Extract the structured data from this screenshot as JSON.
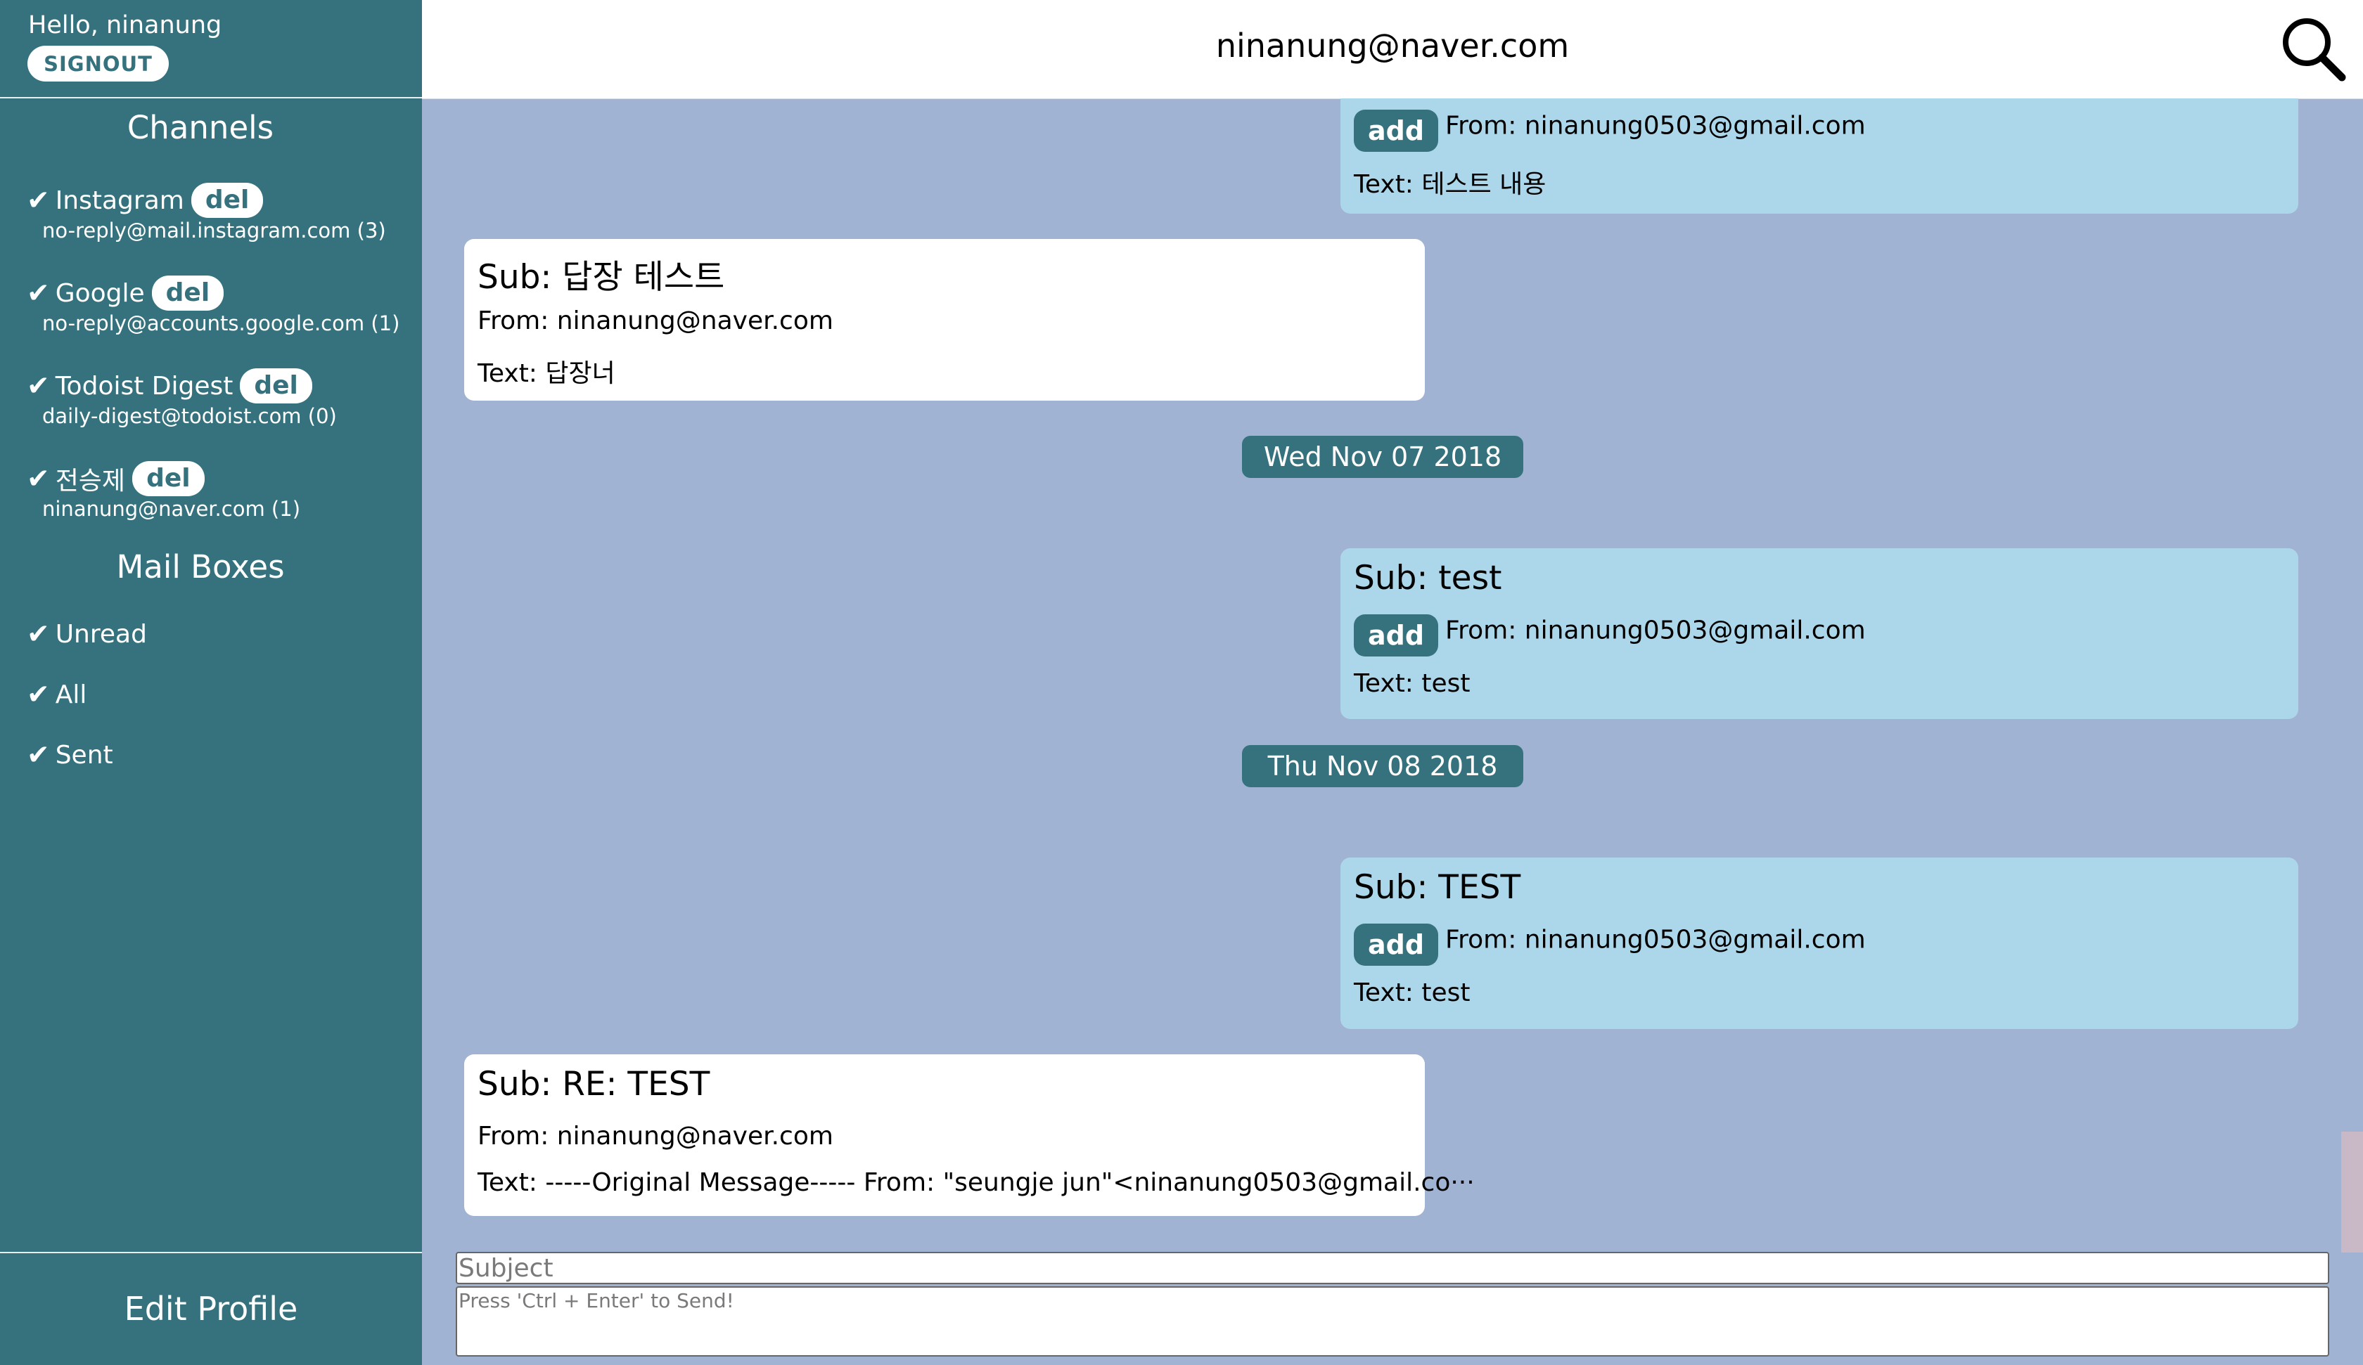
{
  "sidebar": {
    "greeting": "Hello, ninanung",
    "signout_label": "SIGNOUT",
    "channels_title": "Channels",
    "channels": [
      {
        "name": "Instagram",
        "del_label": "del",
        "email": "no-reply@mail.instagram.com (3)"
      },
      {
        "name": "Google",
        "del_label": "del",
        "email": "no-reply@accounts.google.com (1)"
      },
      {
        "name": "Todoist Digest",
        "del_label": "del",
        "email": "daily-digest@todoist.com (0)"
      },
      {
        "name": "전승제",
        "del_label": "del",
        "email": "ninanung@naver.com (1)"
      }
    ],
    "mailboxes_title": "Mail Boxes",
    "mailboxes": [
      {
        "label": "Unread"
      },
      {
        "label": "All"
      },
      {
        "label": "Sent"
      }
    ],
    "check_glyph": "✔",
    "edit_profile_label": "Edit Profile"
  },
  "header": {
    "title": "ninanung@naver.com",
    "search_icon": "search-icon"
  },
  "messages": [
    {
      "type": "received",
      "add_label": "add",
      "from": "From: ninanung0503@gmail.com",
      "text": "Text: 테스트 내용"
    },
    {
      "type": "sent",
      "subject": "Sub: 답장 테스트",
      "from": "From: ninanung@naver.com",
      "text": "Text: 답장너"
    },
    {
      "type": "received",
      "subject": "Sub: test",
      "add_label": "add",
      "from": "From: ninanung0503@gmail.com",
      "text": "Text: test"
    },
    {
      "type": "received",
      "subject": "Sub: TEST",
      "add_label": "add",
      "from": "From: ninanung0503@gmail.com",
      "text": "Text: test"
    },
    {
      "type": "sent",
      "subject": "Sub: RE: TEST",
      "from": "From: ninanung@naver.com",
      "text": "Text: -----Original Message----- From: \"seungje jun\"<ninanung0503@gmail.co···"
    }
  ],
  "dates": [
    "Wed Nov 07 2018",
    "Thu Nov 08 2018"
  ],
  "compose": {
    "subject_placeholder": "Subject",
    "body_placeholder": "Press 'Ctrl + Enter' to Send!"
  },
  "colors": {
    "sidebar": "#35727e",
    "background": "#a1b3d2",
    "received_bubble": "#acd6ea",
    "sent_bubble": "#ffffff"
  }
}
